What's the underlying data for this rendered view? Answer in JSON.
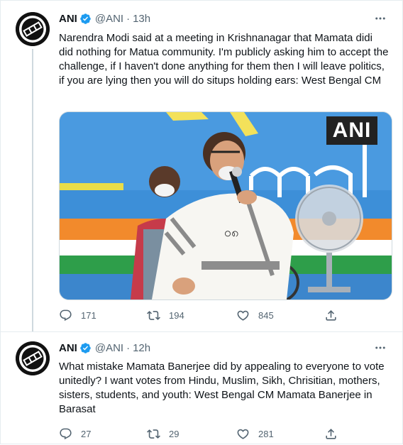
{
  "colors": {
    "text_primary": "#0f1419",
    "text_secondary": "#536471",
    "verified_badge": "#1d9bf0",
    "divider": "#e6ecf0"
  },
  "tweets": [
    {
      "author_name": "ANI",
      "handle": "@ANI",
      "separator": "·",
      "time": "13h",
      "text": "Narendra Modi said at a meeting in Krishnanagar that Mamata didi did nothing for Matua community. I'm publicly asking him to accept the challenge, if I haven't done anything for them then I will leave politics, if you are lying then you will do situps holding ears: West Bengal CM",
      "media_watermark": "ANI",
      "replies": "171",
      "retweets": "194",
      "likes": "845",
      "avatar_icon": "ani-logo-icon",
      "more_icon": "more-options-icon"
    },
    {
      "author_name": "ANI",
      "handle": "@ANI",
      "separator": "·",
      "time": "12h",
      "text": "What mistake Mamata Banerjee did by appealing to everyone to vote unitedly? I want votes from Hindu, Muslim, Sikh, Chrisitian, mothers, sisters, students, and youth: West Bengal CM Mamata Banerjee in Barasat",
      "replies": "27",
      "retweets": "29",
      "likes": "281",
      "avatar_icon": "ani-logo-icon",
      "more_icon": "more-options-icon"
    }
  ]
}
